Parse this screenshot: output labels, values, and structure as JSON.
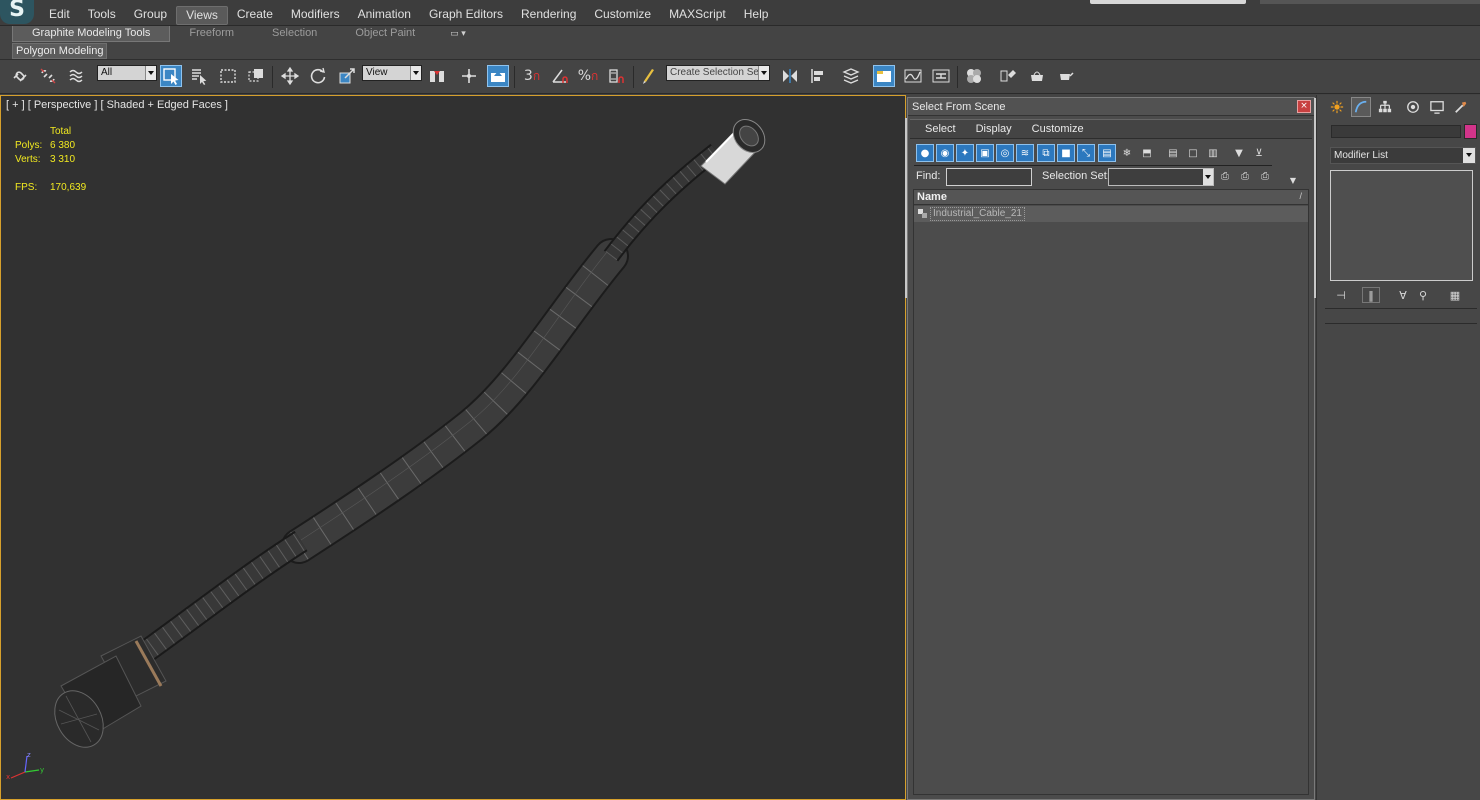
{
  "app": {
    "logo_glyph": "S"
  },
  "menubar": {
    "items": [
      "Edit",
      "Tools",
      "Group",
      "Views",
      "Create",
      "Modifiers",
      "Animation",
      "Graph Editors",
      "Rendering",
      "Customize",
      "MAXScript",
      "Help"
    ],
    "active": "Views"
  },
  "ribbon": {
    "tabs": [
      "Graphite Modeling Tools",
      "Freeform",
      "Selection",
      "Object Paint"
    ],
    "active_tab": "Graphite Modeling Tools",
    "panel_label": "Polygon Modeling",
    "toggle_glyph": "▭ ▾"
  },
  "toolbar": {
    "selection_filter": "All",
    "reference_coord": "View",
    "snap_3_label": "3",
    "percent_snap_label": "%",
    "named_selection_placeholder": "Create Selection Se"
  },
  "viewport": {
    "label": "[ + ] [ Perspective ] [ Shaded + Edged Faces ]",
    "stats": {
      "header": "Total",
      "polys_label": "Polys:",
      "polys_value": "6 380",
      "verts_label": "Verts:",
      "verts_value": "3 310",
      "fps_label": "FPS:",
      "fps_value": "170,639"
    },
    "accent_border": "#d6a02c",
    "stats_color": "#f2ea20"
  },
  "select_from_scene": {
    "title": "Select From Scene",
    "menu": [
      "Select",
      "Display",
      "Customize"
    ],
    "find_label": "Find:",
    "find_value": "",
    "selection_set_label": "Selection Set:",
    "selection_set_value": "",
    "column_name": "Name",
    "sort_glyph": "/",
    "rows": [
      {
        "name": "Industrial_Cable_21"
      }
    ],
    "accent": "#2c78be"
  },
  "command_panel": {
    "modifier_list": "Modifier List",
    "object_color": "#d2348a"
  }
}
